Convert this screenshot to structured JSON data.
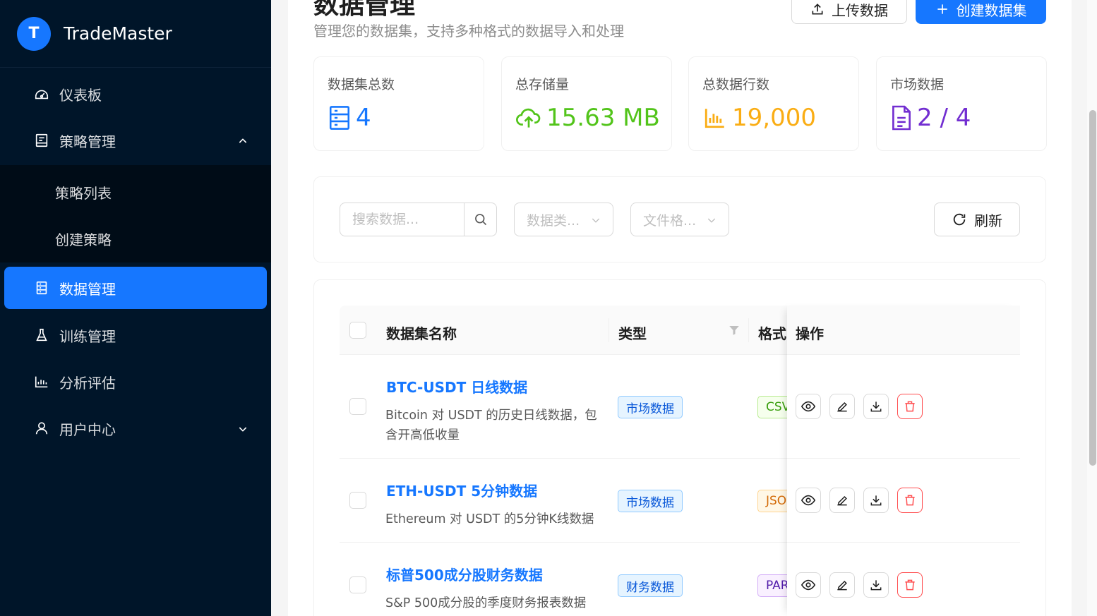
{
  "app": {
    "logo_letter": "T",
    "name": "TradeMaster"
  },
  "sidebar": {
    "items": [
      {
        "label": "仪表板",
        "icon": "dashboard-icon"
      },
      {
        "label": "策略管理",
        "icon": "strategy-icon",
        "expanded": true
      },
      {
        "label": "数据管理",
        "icon": "database-icon",
        "active": true
      },
      {
        "label": "训练管理",
        "icon": "flask-icon"
      },
      {
        "label": "分析评估",
        "icon": "bar-chart-icon"
      },
      {
        "label": "用户中心",
        "icon": "user-icon",
        "expanded": false
      }
    ],
    "sub_items": [
      {
        "label": "策略列表"
      },
      {
        "label": "创建策略"
      }
    ]
  },
  "header": {
    "title": "数据管理",
    "subtitle": "管理您的数据集，支持多种格式的数据导入和处理",
    "upload_label": "上传数据",
    "create_label": "创建数据集"
  },
  "stats": [
    {
      "label": "数据集总数",
      "value": "4",
      "color": "#1677ff",
      "icon": "database-icon"
    },
    {
      "label": "总存储量",
      "value": "15.63 MB",
      "color": "#52c41a",
      "icon": "cloud-upload-icon"
    },
    {
      "label": "总数据行数",
      "value": "19,000",
      "color": "#faad14",
      "icon": "bar-chart-icon"
    },
    {
      "label": "市场数据",
      "value": "2 / 4",
      "color": "#722ed1",
      "icon": "file-text-icon"
    }
  ],
  "filters": {
    "search_placeholder": "搜索数据...",
    "type_placeholder": "数据类...",
    "format_placeholder": "文件格...",
    "refresh_label": "刷新"
  },
  "table": {
    "columns": {
      "name": "数据集名称",
      "type": "类型",
      "format": "格式",
      "actions": "操作"
    },
    "rows": [
      {
        "name": "BTC-USDT 日线数据",
        "desc": "Bitcoin 对 USDT 的历史日线数据，包含开高低收量",
        "type": "市场数据",
        "format": "CSV",
        "format_color": "#389e0d",
        "format_bg": "#f6ffed",
        "format_border": "#b7eb8f"
      },
      {
        "name": "ETH-USDT 5分钟数据",
        "desc": "Ethereum 对 USDT 的5分钟K线数据",
        "type": "市场数据",
        "format": "JSON",
        "format_color": "#d46b08",
        "format_bg": "#fff7e6",
        "format_border": "#ffd591"
      },
      {
        "name": "标普500成分股财务数据",
        "desc": "S&P 500成分股的季度财务报表数据",
        "type": "财务数据",
        "format": "PARQUET",
        "format_color": "#531dab",
        "format_bg": "#f9f0ff",
        "format_border": "#d3adf7"
      }
    ]
  }
}
